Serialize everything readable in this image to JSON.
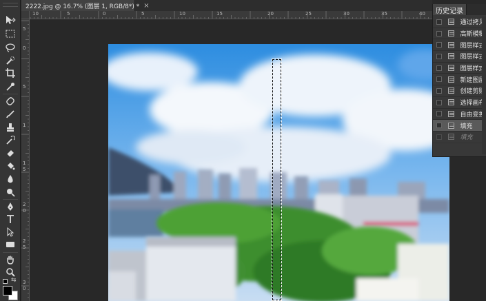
{
  "document_tab": {
    "title": "2222.jpg @ 16.7% (图层 1, RGB/8*) *",
    "close_glyph": "×"
  },
  "ruler": {
    "top_labels": [
      "10",
      "5",
      "0",
      "5",
      "10",
      "15",
      "20",
      "25",
      "30",
      "35",
      "40"
    ],
    "left_labels": [
      "5",
      "0",
      "5",
      "1",
      "1",
      "5",
      "2",
      "0",
      "2",
      "5",
      "3",
      "0"
    ]
  },
  "tools": [
    {
      "name": "move-tool-icon"
    },
    {
      "name": "marquee-tool-icon"
    },
    {
      "name": "lasso-tool-icon"
    },
    {
      "name": "quick-select-tool-icon"
    },
    {
      "name": "crop-tool-icon"
    },
    {
      "name": "eyedropper-tool-icon"
    },
    {
      "name": "healing-brush-tool-icon"
    },
    {
      "name": "brush-tool-icon"
    },
    {
      "name": "clone-stamp-tool-icon"
    },
    {
      "name": "history-brush-tool-icon"
    },
    {
      "name": "eraser-tool-icon"
    },
    {
      "name": "paint-bucket-tool-icon"
    },
    {
      "name": "blur-tool-icon"
    },
    {
      "name": "dodge-tool-icon"
    },
    {
      "name": "pen-tool-icon"
    },
    {
      "name": "type-tool-icon"
    },
    {
      "name": "path-select-tool-icon"
    },
    {
      "name": "shape-tool-icon"
    },
    {
      "name": "hand-tool-icon"
    },
    {
      "name": "zoom-tool-icon"
    }
  ],
  "colors": {
    "foreground": "#000000",
    "background": "#ffffff"
  },
  "history_panel": {
    "tab_label": "历史记录",
    "items": [
      {
        "label": "通过拷贝",
        "state": "normal"
      },
      {
        "label": "高斯模糊",
        "state": "normal"
      },
      {
        "label": "图层样式",
        "state": "normal"
      },
      {
        "label": "图层样式",
        "state": "normal"
      },
      {
        "label": "图层样式",
        "state": "normal"
      },
      {
        "label": "新建图层",
        "state": "normal"
      },
      {
        "label": "创建剪贴",
        "state": "normal"
      },
      {
        "label": "选择画布",
        "state": "normal"
      },
      {
        "label": "自由变换",
        "state": "normal"
      },
      {
        "label": "填充",
        "state": "selected"
      },
      {
        "label": "填充",
        "state": "undone"
      }
    ]
  }
}
